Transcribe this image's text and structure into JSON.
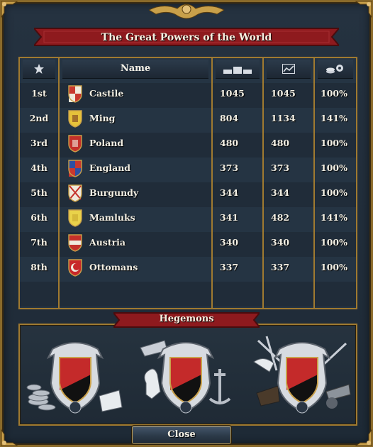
{
  "window": {
    "title": "The Great Powers of the World",
    "close_label": "Close"
  },
  "table": {
    "headers": {
      "rank_icon": "star-icon",
      "name": "Name",
      "score_icon": "bars-icon",
      "trend_icon": "trend-chart-icon",
      "pct_icon": "coins-gear-icon"
    },
    "rows": [
      {
        "rank": "1st",
        "name": "Castile",
        "score": "1045",
        "trend": "1045",
        "pct": "100%",
        "flag": {
          "kind": "quarters",
          "a": "#c8382f",
          "b": "#f0eadd"
        }
      },
      {
        "rank": "2nd",
        "name": "Ming",
        "score": "804",
        "trend": "1134",
        "pct": "141%",
        "flag": {
          "kind": "plain",
          "a": "#e6c23a",
          "b": "#7a3b1e"
        }
      },
      {
        "rank": "3rd",
        "name": "Poland",
        "score": "480",
        "trend": "480",
        "pct": "100%",
        "flag": {
          "kind": "plain",
          "a": "#c4302a",
          "b": "#f0eadd"
        }
      },
      {
        "rank": "4th",
        "name": "England",
        "score": "373",
        "trend": "373",
        "pct": "100%",
        "flag": {
          "kind": "quarters",
          "a": "#2e4fa3",
          "b": "#c8382f"
        }
      },
      {
        "rank": "5th",
        "name": "Burgundy",
        "score": "344",
        "trend": "344",
        "pct": "100%",
        "flag": {
          "kind": "saltire",
          "a": "#f0eadd",
          "b": "#c4302a"
        }
      },
      {
        "rank": "6th",
        "name": "Mamluks",
        "score": "341",
        "trend": "482",
        "pct": "141%",
        "flag": {
          "kind": "plain",
          "a": "#e9d24a",
          "b": "#c9a830"
        }
      },
      {
        "rank": "7th",
        "name": "Austria",
        "score": "340",
        "trend": "340",
        "pct": "100%",
        "flag": {
          "kind": "fess",
          "a": "#c4302a",
          "b": "#f0eadd"
        }
      },
      {
        "rank": "8th",
        "name": "Ottomans",
        "score": "337",
        "trend": "337",
        "pct": "100%",
        "flag": {
          "kind": "crescent",
          "a": "#c8282a",
          "b": "#f0eadd"
        }
      }
    ]
  },
  "hegemons": {
    "title": "Hegemons",
    "items": [
      {
        "name": "economic-hegemon",
        "icon": "coins-scroll-icon",
        "colors": [
          "#c42a2a",
          "#111111"
        ]
      },
      {
        "name": "naval-hegemon",
        "icon": "horse-anchor-icon",
        "colors": [
          "#c42a2a",
          "#111111"
        ]
      },
      {
        "name": "military-hegemon",
        "icon": "weapons-cannon-icon",
        "colors": [
          "#c42a2a",
          "#111111"
        ]
      }
    ]
  },
  "colors": {
    "gold_border": "#a07a30",
    "panel": "#1f2b38",
    "banner_red": "#8e1a1e"
  }
}
